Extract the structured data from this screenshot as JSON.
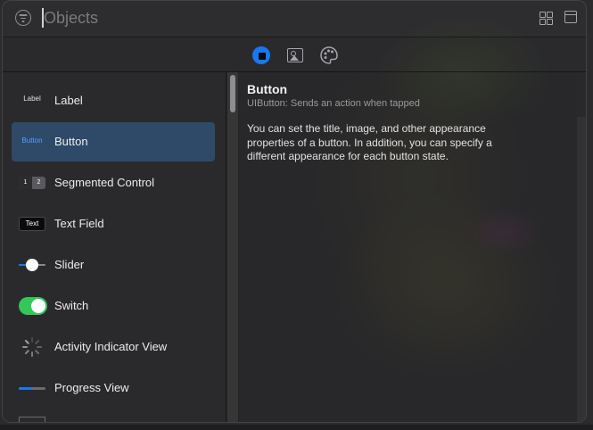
{
  "search": {
    "placeholder": "Objects",
    "value": ""
  },
  "tabs": [
    {
      "id": "objects",
      "icon": "objects-icon",
      "selected": true
    },
    {
      "id": "media",
      "icon": "image-icon",
      "selected": false
    },
    {
      "id": "colors",
      "icon": "palette-icon",
      "selected": false
    }
  ],
  "library": {
    "items": [
      {
        "label": "Label",
        "thumb_text": "Label"
      },
      {
        "label": "Button",
        "thumb_text": "Button"
      },
      {
        "label": "Segmented Control",
        "thumb_text": [
          "1",
          "2"
        ]
      },
      {
        "label": "Text Field",
        "thumb_text": "Text"
      },
      {
        "label": "Slider",
        "value": 0.5
      },
      {
        "label": "Switch",
        "on": true
      },
      {
        "label": "Activity Indicator View"
      },
      {
        "label": "Progress View",
        "value": 0.5
      }
    ],
    "selected_index": 1
  },
  "detail": {
    "title": "Button",
    "subtitle": "UIButton: Sends an action when tapped",
    "description": "You can set the title, image, and other appearance properties of a button. In addition, you can specify a different appearance for each button state."
  },
  "colors": {
    "accent": "#1877f2",
    "selection": "#2f4a68",
    "switch_on": "#34c759"
  }
}
